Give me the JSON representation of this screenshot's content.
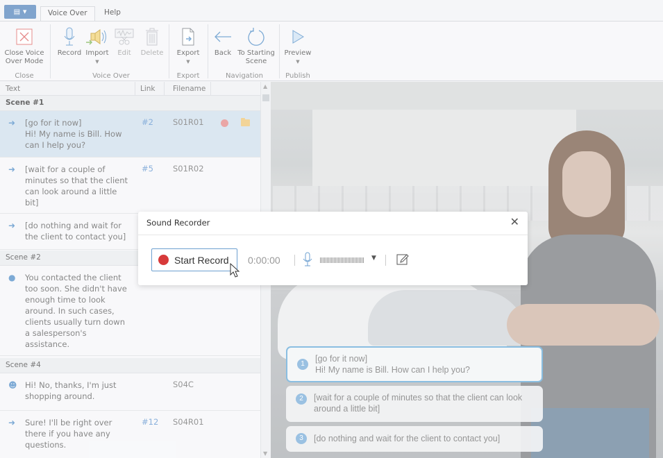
{
  "ribbon": {
    "tabs": [
      "Voice Over",
      "Help"
    ],
    "buttons": {
      "close_voice_over": "Close Voice Over Mode",
      "record": "Record",
      "import": "Import",
      "edit": "Edit",
      "delete": "Delete",
      "export": "Export",
      "back": "Back",
      "to_starting_scene": "To Starting Scene",
      "preview": "Preview"
    },
    "groups": {
      "close": "Close",
      "voice_over": "Voice Over",
      "export": "Export",
      "navigation": "Navigation",
      "publish": "Publish"
    }
  },
  "list": {
    "columns": [
      "Text",
      "Link",
      "Filename"
    ],
    "scenes": [
      {
        "title": "Scene #1"
      },
      {
        "title": "Scene #2"
      },
      {
        "title": "Scene #4"
      }
    ],
    "rows": [
      {
        "icon": "arrow-right-icon",
        "text": "[go for it now]\nHi! My name is Bill. How can I help you?",
        "link": "#2",
        "file": "S01R01"
      },
      {
        "icon": "arrow-right-icon",
        "text": "[wait for a couple of minutes so that the client can look around a little bit]",
        "link": "#5",
        "file": "S01R02"
      },
      {
        "icon": "arrow-right-icon",
        "text": "[do nothing and wait for the client to contact you]",
        "link": "",
        "file": ""
      },
      {
        "icon": "speech-bubble-icon",
        "text": "You contacted the client too soon. She didn't have enough time to look around. In such cases, clients usually turn down  a salesperson's assistance.",
        "link": "",
        "file": ""
      },
      {
        "icon": "person-icon",
        "text": "Hi! No, thanks, I'm just shopping around.",
        "link": "",
        "file": "S04C"
      },
      {
        "icon": "arrow-right-icon",
        "text": "Sure! I'll be right over there if you have any questions.",
        "link": "#12",
        "file": "S04R01"
      }
    ]
  },
  "preview": {
    "choices": [
      {
        "num": "1",
        "text": "[go for it now]\nHi! My name is Bill. How can I help you?"
      },
      {
        "num": "2",
        "text": "[wait for a couple of minutes so that the client can look around a little bit]"
      },
      {
        "num": "3",
        "text": "[do nothing and wait for the client to contact you]"
      }
    ]
  },
  "dialog": {
    "title": "Sound Recorder",
    "start_label": "Start Record",
    "timer": "0:00:00"
  },
  "colors": {
    "accent": "#6c9fd0",
    "record_red": "#d73a3a",
    "selection": "#d6e4f0"
  }
}
